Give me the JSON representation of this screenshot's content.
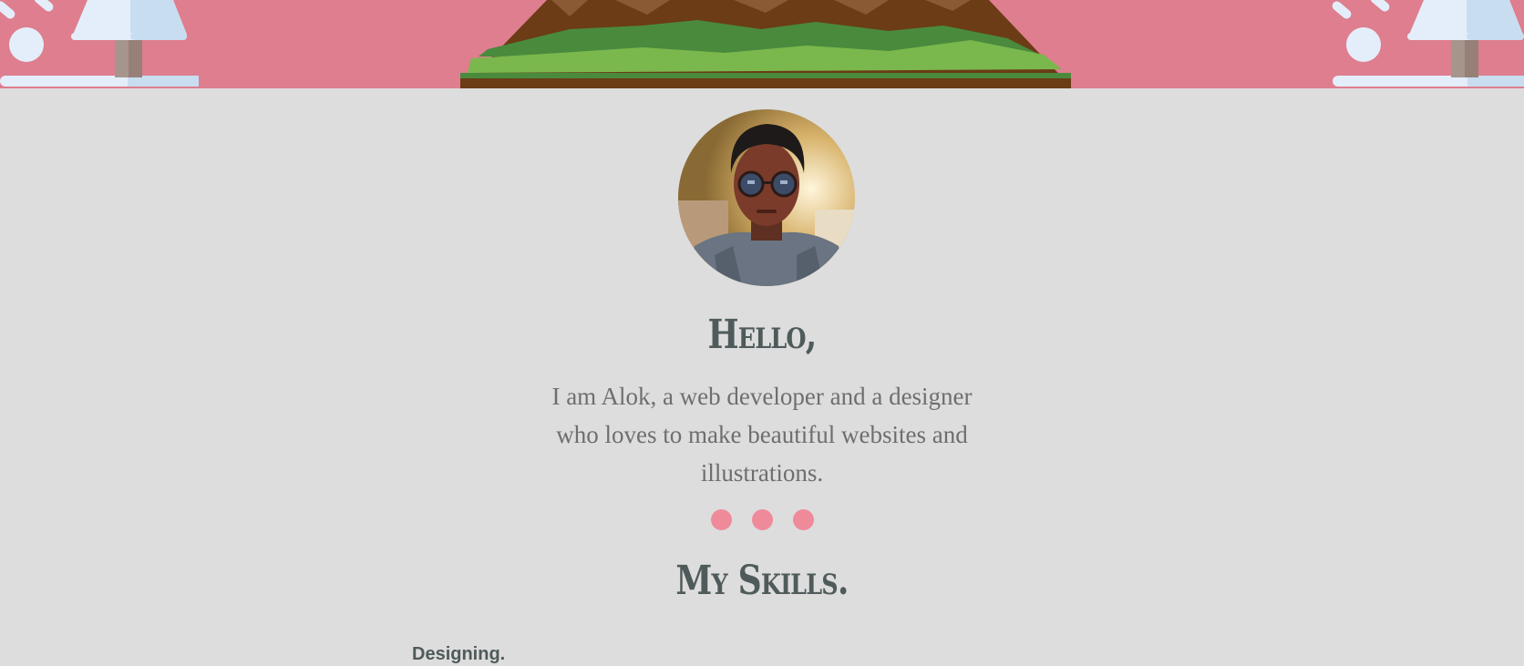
{
  "hero": {
    "background_color": "#de7e8e",
    "mountain_colors": [
      "#6b3c16",
      "#4a8a3d",
      "#7ab84d"
    ],
    "decoration_icons": [
      "tree-icon",
      "snowball-icon"
    ]
  },
  "profile": {
    "photo_name": "avatar"
  },
  "intro": {
    "greeting": "Hello,",
    "text": "I am Alok, a web developer and a designer who loves to make beautiful websites and illustrations."
  },
  "divider": {
    "dot_count": 3,
    "dot_color": "#ef8a9b"
  },
  "skills": {
    "heading": "My Skills.",
    "items": [
      {
        "label": "Designing."
      }
    ]
  }
}
